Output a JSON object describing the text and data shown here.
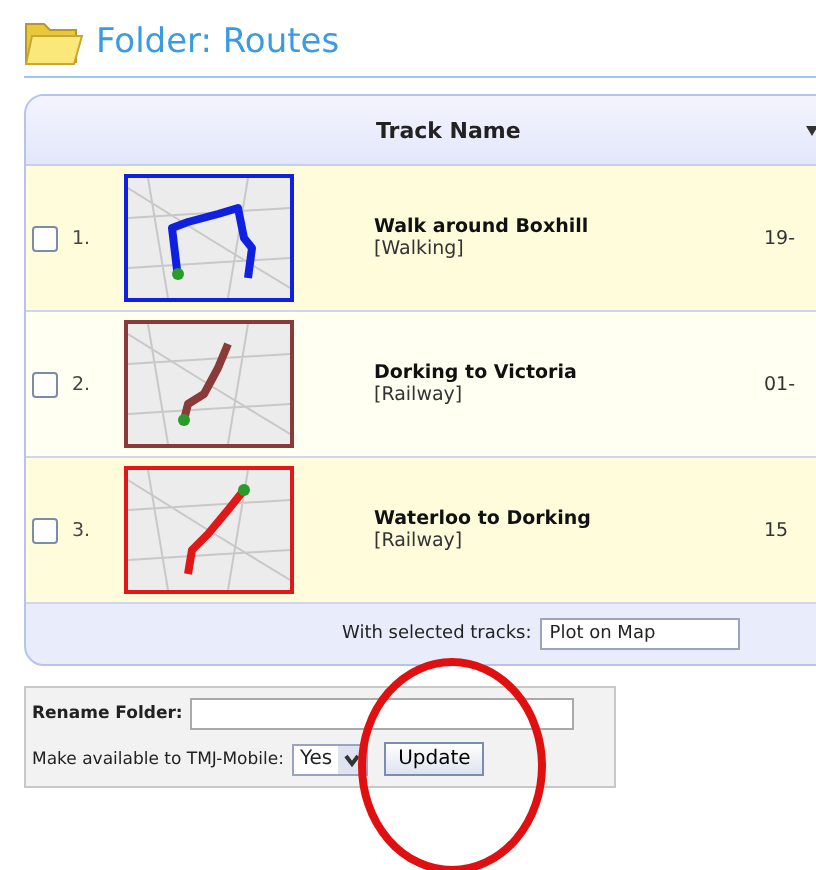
{
  "folder": {
    "title": "Folder: Routes"
  },
  "table": {
    "columns": [
      "Track Name"
    ],
    "rows": [
      {
        "checked": false,
        "number": "1.",
        "name": "Walk around Boxhill",
        "category": "[Walking]",
        "column_3": "19-",
        "color": "#1020e0"
      },
      {
        "checked": false,
        "number": "2.",
        "name": "Dorking to Victoria",
        "category": "[Railway]",
        "column_3": "01-",
        "color": "#8b3a3a"
      },
      {
        "checked": false,
        "number": "3.",
        "name": "Waterloo to Dorking",
        "category": "[Railway]",
        "column_3": "15",
        "color": "#e01818"
      }
    ],
    "footer": {
      "label": "With selected tracks:",
      "action": "Plot on Map"
    }
  },
  "folder_settings": {
    "rename_label": "Rename Folder:",
    "mobile_label": "Make available to TMJ-Mobile:",
    "mobile_value": "Yes",
    "update_button": "Update"
  }
}
